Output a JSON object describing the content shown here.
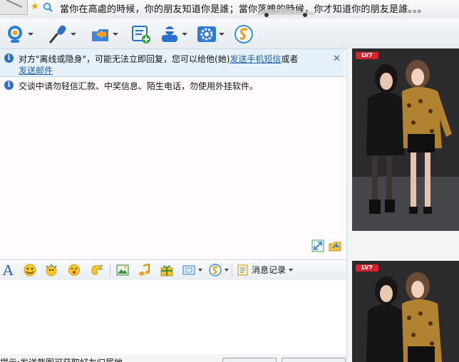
{
  "header": {
    "signature": "當你在高處的時候，你的朋友知道你是誰；當你落魄的時候，你才知道你的朋友是誰。。。"
  },
  "toolbar": {
    "buttons": [
      {
        "icon": "video-call-icon"
      },
      {
        "icon": "voice-call-icon"
      },
      {
        "icon": "file-transfer-icon"
      },
      {
        "icon": "create-group-icon"
      },
      {
        "icon": "remote-assist-icon"
      },
      {
        "icon": "app-settings-icon"
      },
      {
        "icon": "soso-icon"
      }
    ]
  },
  "notices": {
    "offline_text": "对方\"离线或隐身\"，可能无法立即回复，您可以给他(她)",
    "sms_link": "发送手机短信",
    "or_text": "或者",
    "mail_link": "发送邮件",
    "security_warning": "交谈中请勿轻信汇款、中奖信息、陌生电话，勿使用外挂软件。"
  },
  "input_toolbar": {
    "history_label": "消息记录"
  },
  "bottom": {
    "hint": "提示:发送截图可获取好友归属地"
  },
  "right_panel": {
    "badge": "LV7",
    "show_badge": "LV7"
  },
  "colors": {
    "accent": "#2e6fc4",
    "notice_bg": "#e6f1fb",
    "link": "#1f5fb3",
    "badge": "#d8232a"
  }
}
